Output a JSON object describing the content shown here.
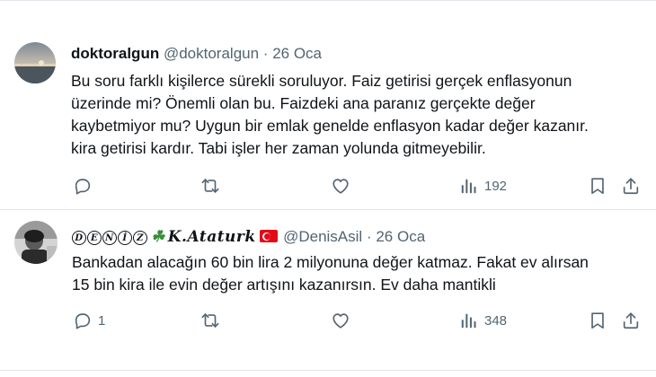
{
  "tweets": [
    {
      "display_name": "doktoralgun",
      "handle": "@doktoralgun",
      "separator": "·",
      "date": "26 Oca",
      "text": "Bu soru farklı kişilerce sürekli soruluyor. Faiz getirisi  gerçek enflasyonun\nüzerinde mi? Önemli olan bu. Faizdeki ana paranız gerçekte değer\nkaybetmiyor mu? Uygun bir emlak genelde enflasyon kadar değer kazanır.\nkira getirisi kardır. Tabi işler her zaman yolunda  gitmeyebilir.",
      "reply_count": "",
      "view_count": "192"
    },
    {
      "display_name_letters": [
        "D",
        "E",
        "N",
        "İ",
        "Z"
      ],
      "display_name_symbol": "☘",
      "display_name_text": "K.Ataturk",
      "handle": "@DenisAsil",
      "separator": "·",
      "date": "26 Oca",
      "text": "Bankadan alacağın 60 bin lira 2 milyonuna değer katmaz. Fakat ev alırsan\n15 bin kira ile evin değer artışını kazanırsın. Ev daha mantikli",
      "reply_count": "1",
      "view_count": "348"
    }
  ],
  "icons": [
    "reply-icon",
    "retweet-icon",
    "like-icon",
    "views-icon",
    "bookmark-icon",
    "share-icon"
  ],
  "colors": {
    "text": "#0f1419",
    "muted": "#536471",
    "divider": "#e1e6ea",
    "flag_red": "#e30a17",
    "clover": "#3a8f3a"
  }
}
